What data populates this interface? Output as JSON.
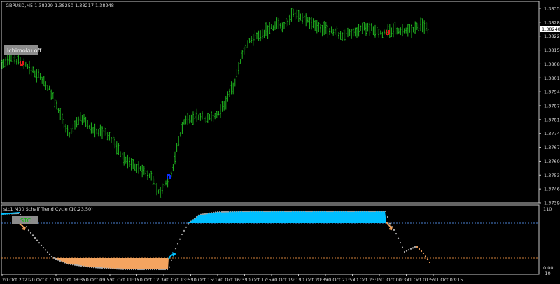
{
  "symbol_header": "GBPUSD,M5  1.38229 1.38250 1.38217 1.38248",
  "ichimoku_button": "Ichimoku off",
  "price_tag": "1.38248",
  "price_axis_labels": [
    "1.38355",
    "1.38285",
    "1.38220",
    "1.38150",
    "1.38080",
    "1.38015",
    "1.37945",
    "1.37875",
    "1.37810",
    "1.37740",
    "1.37670",
    "1.37605",
    "1.37535",
    "1.37465",
    "1.37395"
  ],
  "indicator_title": "stc1 M30 Schaff Trend Cycle (10,23,50)",
  "stc_badge": "STC",
  "indicator_axis_labels": [
    "110",
    "0.00",
    "-10"
  ],
  "time_axis_labels": [
    "20 Oct 2021",
    "20 Oct 07:15",
    "20 Oct 08:35",
    "20 Oct 09:55",
    "20 Oct 11:15",
    "20 Oct 12:35",
    "20 Oct 13:55",
    "20 Oct 15:15",
    "20 Oct 16:35",
    "20 Oct 17:55",
    "20 Oct 19:15",
    "20 Oct 20:35",
    "20 Oct 21:55",
    "20 Oct 23:15",
    "21 Oct 00:35",
    "21 Oct 01:55",
    "21 Oct 03:15"
  ],
  "colors": {
    "bars": "#1fb41f",
    "stc_up": "#00bfff",
    "stc_down": "#f4a460",
    "dots": "#b0b0b0",
    "arrow_up": "#0a2fff",
    "arrow_down": "#e11a1a",
    "axis": "#c8c8c8",
    "dashed_high": "#4a7fd0",
    "dashed_low": "#d2803a"
  },
  "icons": [
    "chart-up-arrow-icon",
    "chart-down-arrow-icon",
    "stc-up-arrow-icon",
    "stc-down-arrow-icon"
  ]
}
